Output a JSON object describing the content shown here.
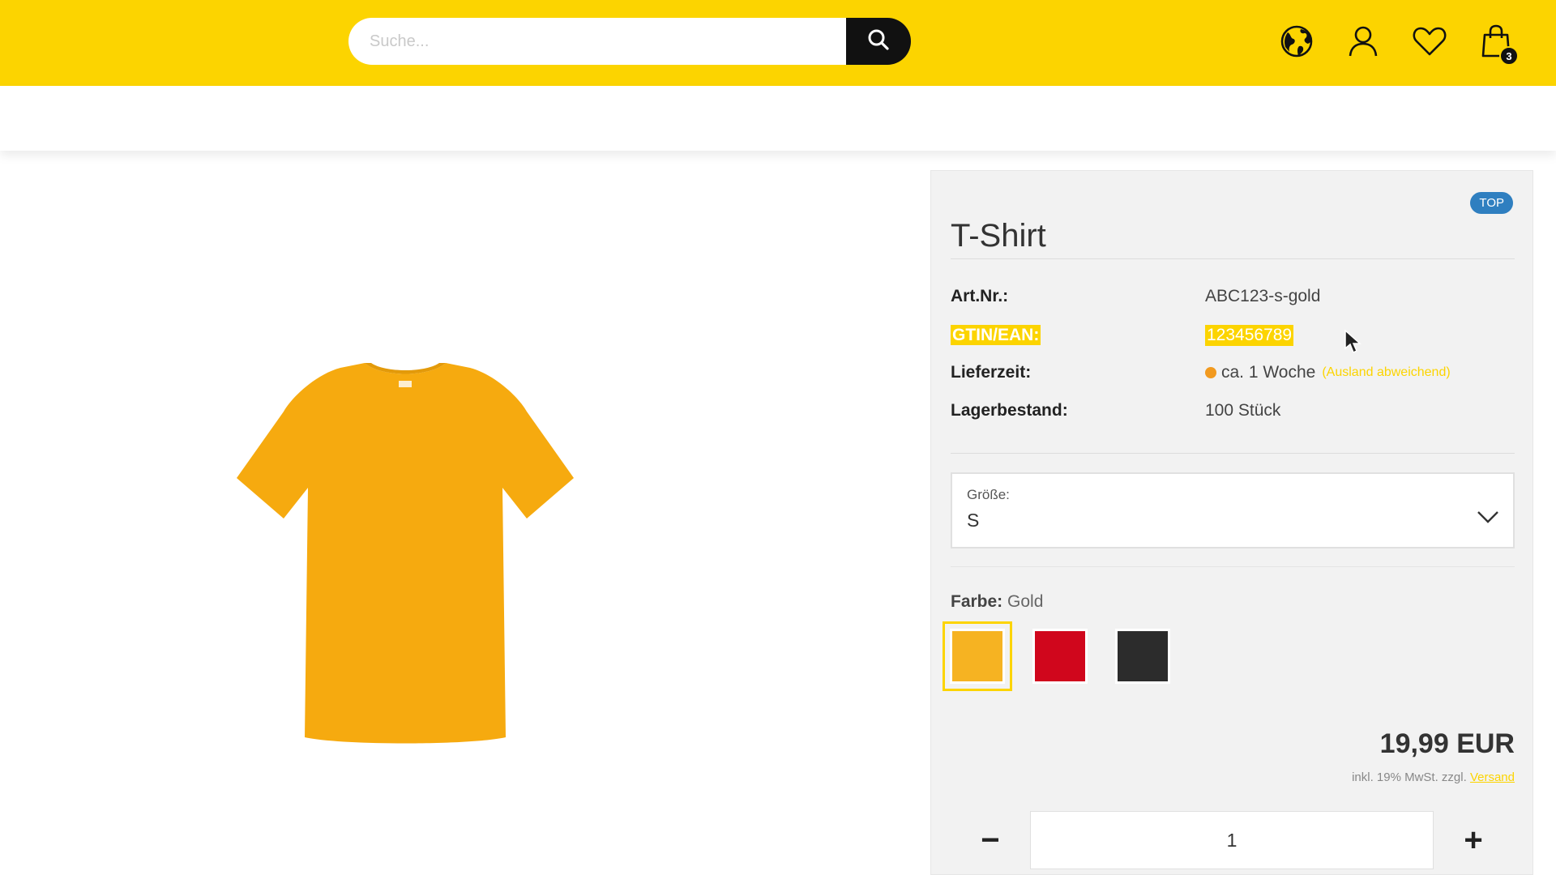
{
  "header": {
    "search": {
      "placeholder": "Suche...",
      "value": ""
    },
    "icons": [
      "globe-icon",
      "user-icon",
      "heart-icon",
      "cart-icon"
    ],
    "cart_count": "3",
    "background_color": "#fcd400"
  },
  "product": {
    "badge": "TOP",
    "title": "T-Shirt",
    "info": {
      "article_label": "Art.Nr.:",
      "article_value": "ABC123-s-gold",
      "gtin_label": "GTIN/EAN:",
      "gtin_value": "123456789",
      "delivery_label": "Lieferzeit:",
      "delivery_value": "ca. 1 Woche",
      "delivery_note": "(Ausland abweichend)",
      "stock_label": "Lagerbestand:",
      "stock_value": "100 Stück"
    },
    "size": {
      "label": "Größe:",
      "value": "S"
    },
    "color": {
      "label": "Farbe:",
      "value": "Gold",
      "swatches": [
        {
          "name": "Gold",
          "hex": "#f6b322",
          "selected": true
        },
        {
          "name": "Rot",
          "hex": "#d0061c",
          "selected": false
        },
        {
          "name": "Schwarz",
          "hex": "#2c2c2c",
          "selected": false
        }
      ]
    },
    "price": "19,99 EUR",
    "tax_note": "inkl. 19% MwSt. zzgl.",
    "shipping_link": "Versand",
    "quantity": {
      "minus": "−",
      "value": "1",
      "plus": "+"
    },
    "image_color": "#f6aa0f"
  }
}
